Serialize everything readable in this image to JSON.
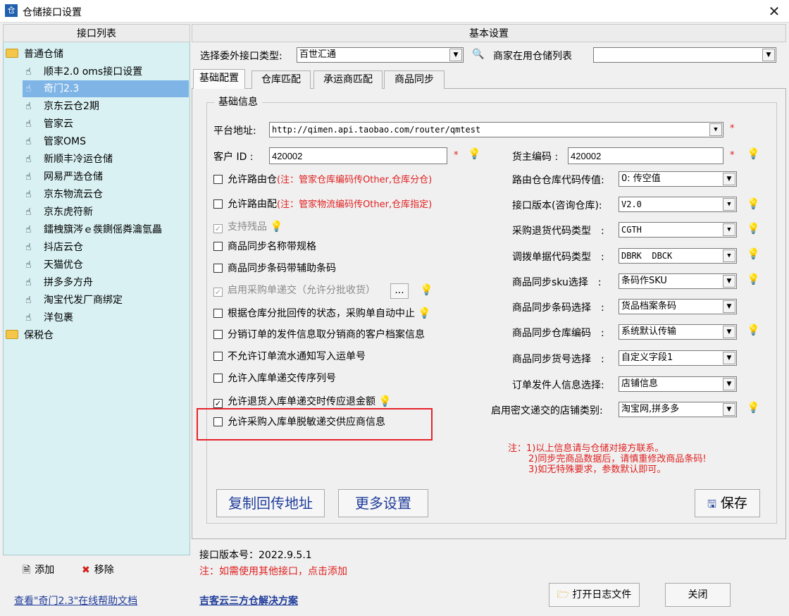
{
  "window": {
    "title": "仓储接口设置",
    "app_icon": "warehouse-app-icon",
    "close": "✕"
  },
  "left": {
    "header": "接口列表",
    "folders": [
      {
        "label": "普通仓储",
        "items": [
          "顺丰2.0 oms接口设置",
          "奇门2.3",
          "京东云仓2期",
          "管家云",
          "管家OMS",
          "新顺丰冷运仓储",
          "网易严选仓储",
          "京东物流云仓",
          "京东虎符新",
          "鐳栧簱涔ｅ彂鍘傜粦瀹氫畾",
          "抖店云仓",
          "天猫优仓",
          "拼多多方舟",
          "淘宝代发厂商绑定",
          "洋包裹"
        ]
      },
      {
        "label": "保税仓",
        "items": []
      }
    ],
    "selected_item": "奇门2.3",
    "add_label": "添加",
    "remove_label": "移除",
    "help_link": "查看\"奇门2.3\"在线帮助文档"
  },
  "right": {
    "header": "基本设置",
    "type_label": "选择委外接口类型:",
    "type_value": "百世汇通",
    "merchant_label": "商家在用仓储列表",
    "merchant_value": "",
    "tabs": [
      "基础配置",
      "仓库匹配",
      "承运商匹配",
      "商品同步"
    ],
    "active_tab": "基础配置",
    "group_title": "基础信息",
    "platform_label": "平台地址:",
    "platform_value": "http://qimen.api.taobao.com/router/qmtest",
    "customer_label": "客户 ID :",
    "customer_value": "420002",
    "owner_label": "货主编码 :",
    "owner_value": "420002",
    "star": "*",
    "checkboxes": [
      {
        "label": "允许路由仓",
        "note": "(注：管家仓库编码传Other,仓库分仓)",
        "checked": false,
        "disabled": false
      },
      {
        "label": "允许路由配",
        "note": "(注：管家物流编码传Other,仓库指定)",
        "checked": false,
        "disabled": false
      },
      {
        "label": "支持残品",
        "note": "",
        "checked": true,
        "disabled": true
      },
      {
        "label": "商品同步名称带规格",
        "note": "",
        "checked": false,
        "disabled": false
      },
      {
        "label": "商品同步条码带辅助条码",
        "note": "",
        "checked": false,
        "disabled": false
      },
      {
        "label": "启用采购单递交（允许分批收货）",
        "note": "",
        "checked": true,
        "disabled": true
      },
      {
        "label": "根据仓库分批回传的状态，采购单自动中止",
        "note": "",
        "checked": false,
        "disabled": false
      },
      {
        "label": "分销订单的发件信息取分销商的客户档案信息",
        "note": "",
        "checked": false,
        "disabled": false
      },
      {
        "label": "不允许订单流水通知写入运单号",
        "note": "",
        "checked": false,
        "disabled": false
      },
      {
        "label": "允许入库单递交传序列号",
        "note": "",
        "checked": false,
        "disabled": false
      },
      {
        "label": "允许退货入库单递交时传应退金额",
        "note": "",
        "checked": true,
        "disabled": false
      },
      {
        "label": "允许采购入库单脱敏递交供应商信息",
        "note": "",
        "checked": false,
        "disabled": false
      }
    ],
    "ellipsis": "...",
    "fields": [
      {
        "label": "路由仓仓库代码传值:",
        "value": "0: 传空值"
      },
      {
        "label": "接口版本(咨询仓库):",
        "value": "V2.0"
      },
      {
        "label": "采购退货代码类型　:",
        "value": "CGTH"
      },
      {
        "label": "调拨单据代码类型　:",
        "value": "DBRK  DBCK"
      },
      {
        "label": "商品同步sku选择　:",
        "value": "条码作SKU"
      },
      {
        "label": "商品同步条码选择　:",
        "value": "货品档案条码"
      },
      {
        "label": "商品同步仓库编码　:",
        "value": "系统默认传输"
      },
      {
        "label": "商品同步货号选择　:",
        "value": "自定义字段1"
      },
      {
        "label": "订单发件人信息选择:",
        "value": "店铺信息"
      },
      {
        "label": "启用密文递交的店铺类别:",
        "value": "淘宝网,拼多多"
      }
    ],
    "notes": [
      "注：1)以上信息请与仓储对接方联系。",
      "2)同步完商品数据后，请慎重修改商品条码!",
      "3)如无特殊要求，参数默认即可。"
    ],
    "copy_btn": "复制回传地址",
    "more_btn": "更多设置",
    "save_btn": "保存",
    "version": "接口版本号：2022.9.5.1",
    "hint": "注：如需使用其他接口，点击添加",
    "solution_link": "吉客云三方仓解决方案",
    "open_log_btn": "打开日志文件",
    "close_btn": "关闭"
  }
}
